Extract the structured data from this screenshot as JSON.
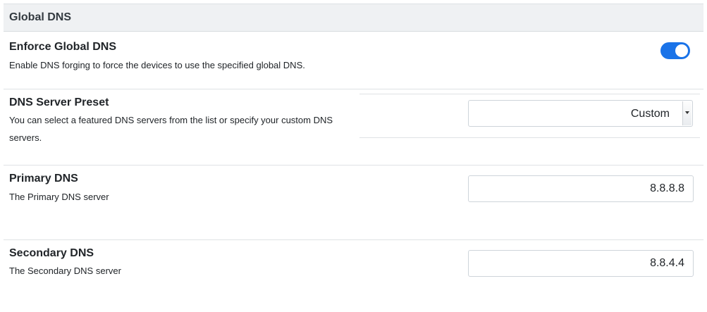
{
  "panel": {
    "title": "Global DNS"
  },
  "enforce": {
    "title": "Enforce Global DNS",
    "description": "Enable DNS forging to force the devices to use the specified global DNS.",
    "enabled": true,
    "accent_color": "#1a73e8"
  },
  "preset": {
    "title": "DNS Server Preset",
    "description_line1": "You can select a featured DNS servers from the list or specify your custom DNS",
    "description_line2": "servers.",
    "selected": "Custom"
  },
  "primary": {
    "title": "Primary DNS",
    "description": "The Primary DNS server",
    "value": "8.8.8.8"
  },
  "secondary": {
    "title": "Secondary DNS",
    "description": "The Secondary DNS server",
    "value": "8.8.4.4"
  }
}
